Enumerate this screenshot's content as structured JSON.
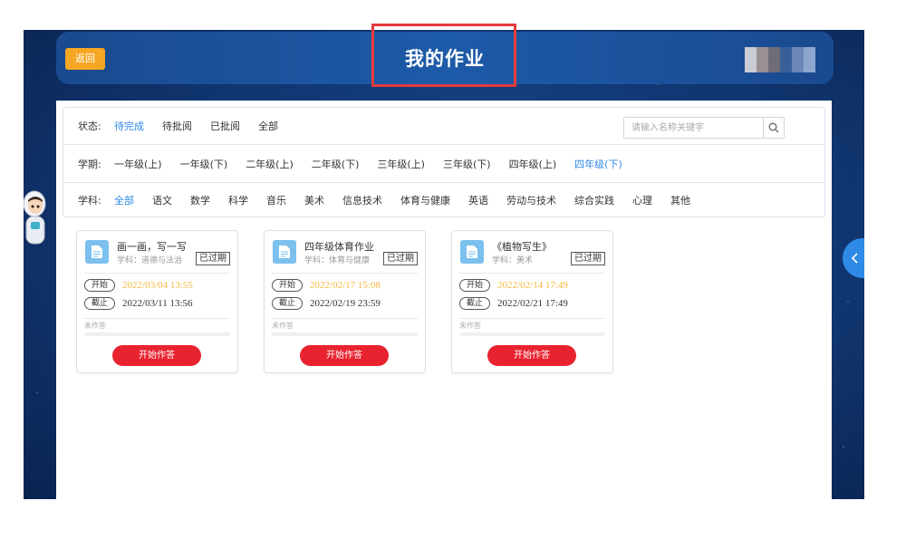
{
  "header": {
    "back_label": "返回",
    "title": "我的作业"
  },
  "filters": {
    "status": {
      "label": "状态:",
      "options": [
        "待完成",
        "待批阅",
        "已批阅",
        "全部"
      ],
      "selected": "待完成"
    },
    "search": {
      "placeholder": "请输入名称关键字"
    },
    "semester": {
      "label": "学期:",
      "options": [
        "一年级(上)",
        "一年级(下)",
        "二年级(上)",
        "二年级(下)",
        "三年级(上)",
        "三年级(下)",
        "四年级(上)",
        "四年级(下)"
      ],
      "selected": "四年级(下)"
    },
    "subject": {
      "label": "学科:",
      "options": [
        "全部",
        "语文",
        "数学",
        "科学",
        "音乐",
        "美术",
        "信息技术",
        "体育与健康",
        "英语",
        "劳动与技术",
        "综合实践",
        "心理",
        "其他"
      ],
      "selected": "全部"
    }
  },
  "assignments": [
    {
      "title": "画一画，写一写",
      "subject": "学科：道德与法治",
      "badge": "已过期",
      "start_label": "开始",
      "start_time": "2022/03/04 13:55",
      "end_label": "截止",
      "end_time": "2022/03/11 13:56",
      "status": "未作答",
      "progress": 0,
      "button": "开始作答"
    },
    {
      "title": "四年级体育作业",
      "subject": "学科：体育与健康",
      "badge": "已过期",
      "start_label": "开始",
      "start_time": "2022/02/17 15:08",
      "end_label": "截止",
      "end_time": "2022/02/19 23:59",
      "status": "未作答",
      "progress": 0,
      "button": "开始作答"
    },
    {
      "title": "《植物写生》",
      "subject": "学科：美术",
      "badge": "已过期",
      "start_label": "开始",
      "start_time": "2022/02/14 17:49",
      "end_label": "截止",
      "end_time": "2022/02/21 17:49",
      "status": "未作答",
      "progress": 0,
      "button": "开始作答"
    }
  ],
  "colors": {
    "accent": "#2e8ae6",
    "start_button": "#e8232f",
    "back_button": "#f5a623",
    "start_time": "#f5b940",
    "highlight": "#e53b3b"
  },
  "icons": {
    "search": "search-icon",
    "document": "document-icon",
    "side_tab": "chevron-left-icon"
  }
}
